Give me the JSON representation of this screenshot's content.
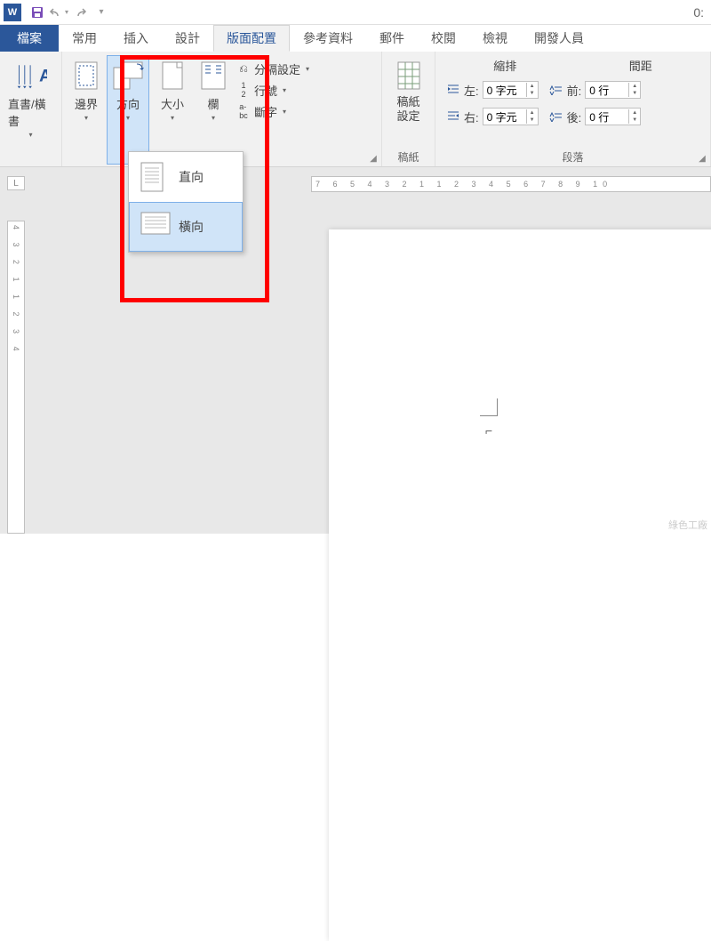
{
  "titlebar": {
    "right_text": "0:"
  },
  "tabs": {
    "file": "檔案",
    "items": [
      "常用",
      "插入",
      "設計",
      "版面配置",
      "參考資料",
      "郵件",
      "校閱",
      "檢視",
      "開發人員"
    ],
    "active_index": 3
  },
  "ribbon": {
    "text_direction": {
      "label": "直書/橫書"
    },
    "margins": {
      "label": "邊界"
    },
    "orientation": {
      "label": "方向"
    },
    "size": {
      "label": "大小"
    },
    "columns": {
      "label": "欄"
    },
    "breaks": "分隔設定",
    "line_numbers": "行號",
    "hyphenation": "斷字",
    "page_setup_group": "",
    "manuscript": {
      "btn": "稿紙\n設定",
      "group": "稿紙"
    },
    "indent": {
      "header": "縮排",
      "left_label": "左:",
      "left_value": "0 字元",
      "right_label": "右:",
      "right_value": "0 字元"
    },
    "spacing": {
      "header": "間距",
      "before_label": "前:",
      "before_value": "0 行",
      "after_label": "後:",
      "after_value": "0 行"
    },
    "paragraph_group": "段落"
  },
  "dropdown": {
    "portrait": "直向",
    "landscape": "橫向"
  },
  "ruler": {
    "h": "7 6 5 4 3 2 1  1 2 3 4 5 6 7 8 9 10",
    "v": "4 3 2 1 1 2 3 4"
  },
  "corner": "L",
  "watermark": "綠色工廠"
}
